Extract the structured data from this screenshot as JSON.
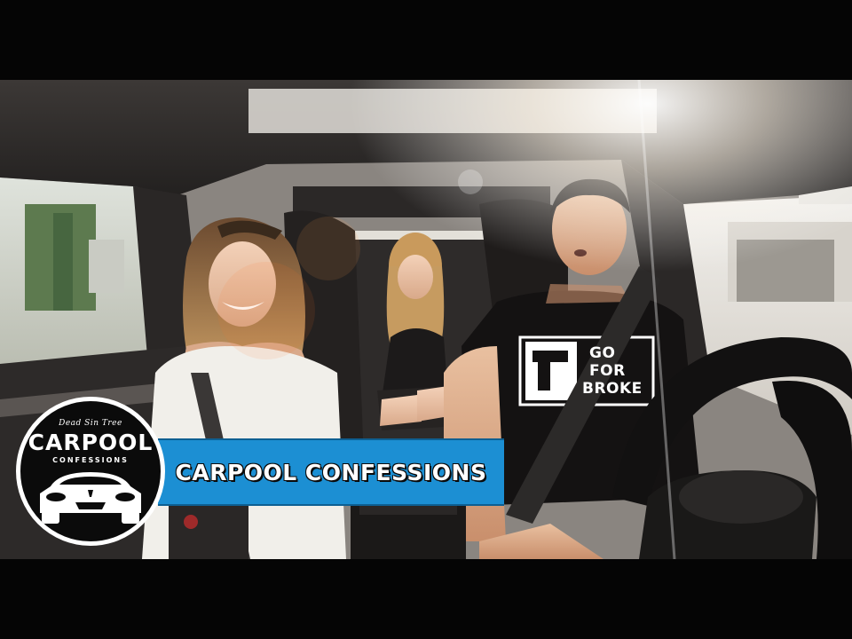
{
  "overlay": {
    "logo": {
      "brand": "Dead Sin Tree",
      "title": "CARPOOL",
      "subtitle": "CONFESSIONS"
    },
    "banner": {
      "text": "CARPOOL CONFESSIONS"
    }
  },
  "scene": {
    "shirt_print_line1": "GO",
    "shirt_print_line2": "FOR",
    "shirt_print_line3": "BROKE"
  },
  "colors": {
    "banner_blue": "#1c8fd3",
    "logo_black": "#0b0b0b",
    "letterbox": "#050505"
  }
}
